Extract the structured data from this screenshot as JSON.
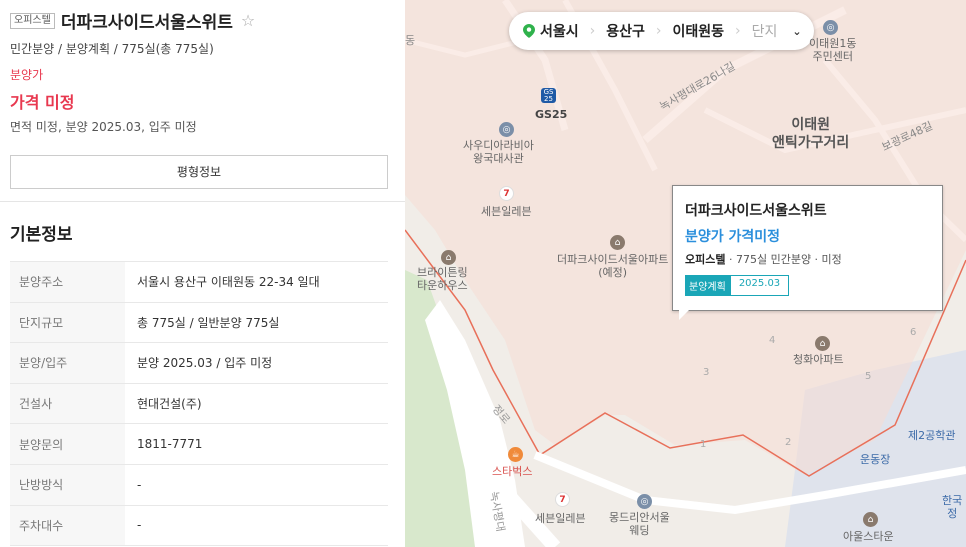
{
  "listing": {
    "type_tag": "오피스텔",
    "title": "더파크사이드서울스위트",
    "star": "☆",
    "subtitle": "민간분양 / 분양계획 / 775실(총 775실)",
    "price_label": "분양가",
    "price": "가격 미정",
    "meta": "면적 미정, 분양 2025.03, 입주 미정",
    "pyung_button": "평형정보"
  },
  "basic_info": {
    "title": "기본정보",
    "rows": [
      {
        "key": "분양주소",
        "value": "서울시 용산구 이태원동 22-34 일대"
      },
      {
        "key": "단지규모",
        "value": "총 775실 / 일반분양 775실"
      },
      {
        "key": "분양/입주",
        "value": "분양 2025.03 / 입주 미정"
      },
      {
        "key": "건설사",
        "value": "현대건설(주)"
      },
      {
        "key": "분양문의",
        "value": "1811-7771"
      },
      {
        "key": "난방방식",
        "value": "-"
      },
      {
        "key": "주차대수",
        "value": "-"
      }
    ]
  },
  "location_bar": {
    "city": "서울시",
    "district": "용산구",
    "dong": "이태원동",
    "complex": "단지",
    "chevron": "⌄"
  },
  "callout": {
    "title": "더파크사이드서울스위트",
    "price": "분양가 가격미정",
    "type": "오피스텔",
    "info": " · 775실 민간분양 · 미정",
    "badge_status": "분양계획",
    "badge_date": "2025.03"
  },
  "map_labels": {
    "gs25": "GS25",
    "gs25_icon": "GS\n25",
    "saudi": "사우디아라비아\n왕국대사관",
    "seven1": "세븐일레븐",
    "seven2": "세븐일레븐",
    "project": "더파크사이드서울아파트\n(예정)",
    "brighton": "브라이튼링\n타운하우스",
    "itaewon1": "이태원1동\n주민센터",
    "antique": "이태원\n앤틱가구거리",
    "road_nokey": "녹사평대로26나길",
    "road_bogwang": "보광로48길",
    "cheongwha": "청화아파트",
    "starbucks": "스타벅스",
    "montreal": "몽드리안서울\n웨딩",
    "no2": "제2공학관",
    "undongjang": "운동장",
    "korea": "한국\n정",
    "aulstar": "아울스타운",
    "road_nokey2": "녹사평대",
    "road_small": "정로",
    "left_edge": "동",
    "n1": "1",
    "n2": "2",
    "n3": "3",
    "n4": "4",
    "n5": "5",
    "n6": "6"
  },
  "colors": {
    "accent_red": "#e8384f",
    "map_blue": "#2b8fdc",
    "teal_badge": "#1aa6b7",
    "boundary": "#e8705a"
  }
}
